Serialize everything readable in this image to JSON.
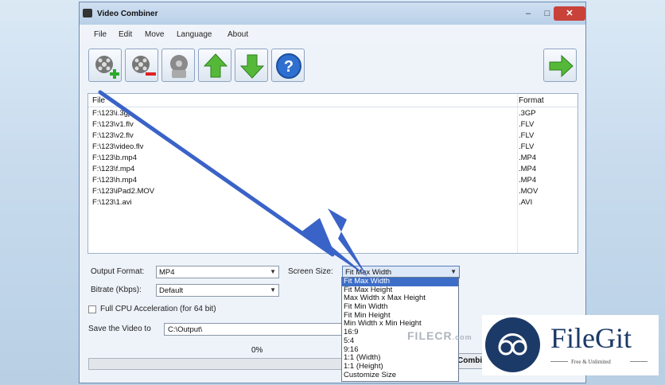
{
  "window": {
    "title": "Video Combiner",
    "minimize": "–",
    "maximize": "□",
    "close": "✕"
  },
  "menu": [
    "File",
    "Edit",
    "Move",
    "Language",
    "About"
  ],
  "toolbar": {
    "add_icon": "film-add-icon",
    "remove_icon": "film-remove-icon",
    "clear_icon": "clear-list-icon",
    "up_icon": "arrow-up-icon",
    "down_icon": "arrow-down-icon",
    "help_icon": "help-icon",
    "next_icon": "arrow-right-icon"
  },
  "file_list": {
    "headers": {
      "file": "File",
      "format": "Format"
    },
    "rows": [
      {
        "file": "F:\\123\\i.3gp",
        "format": ".3GP"
      },
      {
        "file": "F:\\123\\v1.flv",
        "format": ".FLV"
      },
      {
        "file": "F:\\123\\v2.flv",
        "format": ".FLV"
      },
      {
        "file": "F:\\123\\video.flv",
        "format": ".FLV"
      },
      {
        "file": "F:\\123\\b.mp4",
        "format": ".MP4"
      },
      {
        "file": "F:\\123\\f.mp4",
        "format": ".MP4"
      },
      {
        "file": "F:\\123\\h.mp4",
        "format": ".MP4"
      },
      {
        "file": "F:\\123\\iPad2.MOV",
        "format": ".MOV"
      },
      {
        "file": "F:\\123\\1.avi",
        "format": ".AVI"
      }
    ]
  },
  "settings": {
    "output_format_label": "Output Format:",
    "output_format_value": "MP4",
    "screen_size_label": "Screen Size:",
    "screen_size_value": "Fit Max Width",
    "bitrate_label": "Bitrate (Kbps):",
    "bitrate_value": "Default",
    "cpu_label": "Full CPU Acceleration (for 64 bit)",
    "save_label": "Save the Video to",
    "save_value": "C:\\Output\\",
    "progress_text": "0%",
    "progress": 0.0,
    "combine_label": "Combine"
  },
  "screen_size_options": [
    "Fit Max Width",
    "Fit Max Height",
    "Max Width x Max Height",
    "Fit Min Width",
    "Fit Min Height",
    "Min Width x Min Height",
    "16:9",
    "5:4",
    "9:16",
    "1:1 (Width)",
    "1:1 (Height)",
    "Customize Size"
  ],
  "watermark": {
    "text": "FILECR",
    "suffix": ".com"
  },
  "logo": {
    "name": "FileGit",
    "tagline": "Free & Unlimited"
  },
  "colors": {
    "accent": "#3d6ec7",
    "arrow": "#3a63c8",
    "brand": "#1c3a67"
  }
}
